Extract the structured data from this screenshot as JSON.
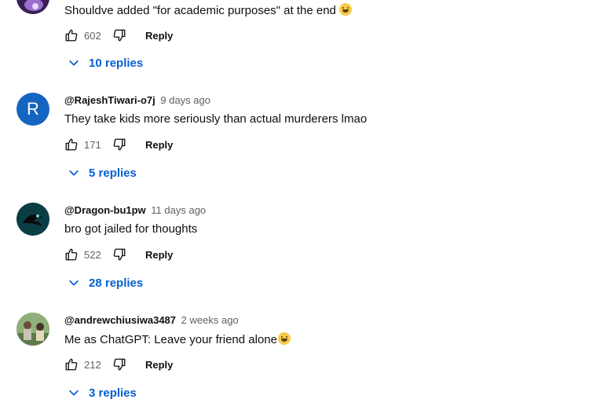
{
  "comments": [
    {
      "author": "",
      "time": "",
      "text": "Shouldve added \"for academic purposes\" at the end",
      "likes": "602",
      "reply_label": "Reply",
      "replies_label": "10 replies",
      "avatar": {
        "letter": "",
        "color": "#4b2a6b"
      },
      "emoji": "laughing-emoji"
    },
    {
      "author": "@RajeshTiwari-o7j",
      "time": "9 days ago",
      "text": "They take kids more seriously than actual murderers lmao",
      "likes": "171",
      "reply_label": "Reply",
      "replies_label": "5 replies",
      "avatar": {
        "letter": "R",
        "color": "#1565c0"
      }
    },
    {
      "author": "@Dragon-bu1pw",
      "time": "11 days ago",
      "text": "bro got jailed for thoughts",
      "likes": "522",
      "reply_label": "Reply",
      "replies_label": "28 replies",
      "avatar": {
        "letter": "",
        "color": "#0b3d45"
      }
    },
    {
      "author": "@andrewchiusiwa3487",
      "time": "2 weeks ago",
      "text": "Me as ChatGPT: Leave your friend alone",
      "likes": "212",
      "reply_label": "Reply",
      "replies_label": "3 replies",
      "avatar": {
        "letter": "",
        "color": "#7aa06a"
      },
      "emoji": "grimacing-emoji"
    }
  ],
  "colors": {
    "link": "#065fd4",
    "meta": "#606060",
    "text": "#0f0f0f"
  }
}
